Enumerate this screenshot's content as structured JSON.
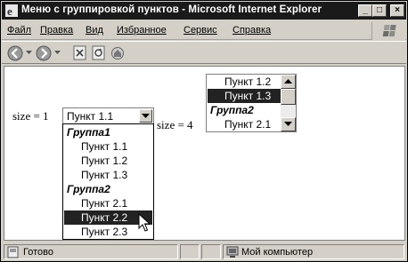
{
  "window": {
    "title": "Меню с группировкой пунктов - Microsoft Internet Explorer",
    "minimize": "_",
    "maximize": "□",
    "close": "×"
  },
  "menu": [
    "Файл",
    "Правка",
    "Вид",
    "Избранное",
    "Сервис",
    "Справка"
  ],
  "toolbar": {
    "icons": [
      "back-icon",
      "dropdown-arrow-icon",
      "forward-icon",
      "dropdown-arrow-icon",
      "stop-icon",
      "refresh-icon",
      "home-icon"
    ]
  },
  "page": {
    "size1_label": "size = 1",
    "size4_label": "size = 4",
    "select1": {
      "value": "Пункт 1.1",
      "options": [
        {
          "type": "group",
          "label": "Группа1"
        },
        {
          "type": "item",
          "label": "Пункт 1.1"
        },
        {
          "type": "item",
          "label": "Пункт 1.2"
        },
        {
          "type": "item",
          "label": "Пункт 1.3"
        },
        {
          "type": "group",
          "label": "Группа2"
        },
        {
          "type": "item",
          "label": "Пункт 2.1"
        },
        {
          "type": "item",
          "label": "Пункт 2.2",
          "highlighted": true
        },
        {
          "type": "item",
          "label": "Пункт 2.3"
        }
      ]
    },
    "listbox": {
      "options": [
        {
          "type": "item",
          "label": "Пункт 1.2"
        },
        {
          "type": "item",
          "label": "Пункт 1.3",
          "selected": true
        },
        {
          "type": "group",
          "label": "Группа2"
        },
        {
          "type": "item",
          "label": "Пункт 2.1"
        }
      ]
    }
  },
  "status": {
    "text": "Готово",
    "zone": "Мой компьютер"
  },
  "colors": {
    "titlebar": "#1a1a1a",
    "chrome": "#d4d0c8",
    "selection": "#222222"
  }
}
